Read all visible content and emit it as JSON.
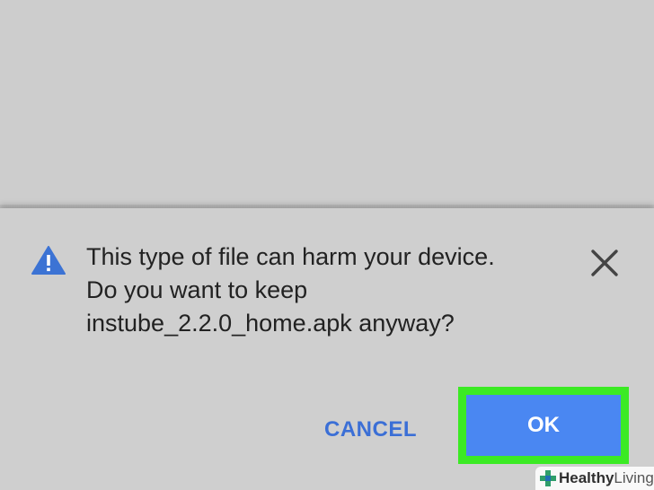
{
  "dialog": {
    "message_line1": "This type of file can harm your device.",
    "message_line2": "Do you want to keep",
    "message_line3": "instube_2.2.0_home.apk anyway?",
    "cancel_label": "CANCEL",
    "ok_label": "OK"
  },
  "watermark": {
    "brand_bold": "Healthy",
    "brand_regular": "Living"
  },
  "colors": {
    "cancel_text": "#3b6fd6",
    "ok_button": "#4a87f2",
    "highlight": "#3bea24",
    "warning_icon": "#3c73d4",
    "background": "#cfcfcf"
  },
  "icons": {
    "warning": "warning-triangle-icon",
    "close": "close-icon",
    "watermark": "plus-cross-icon"
  }
}
